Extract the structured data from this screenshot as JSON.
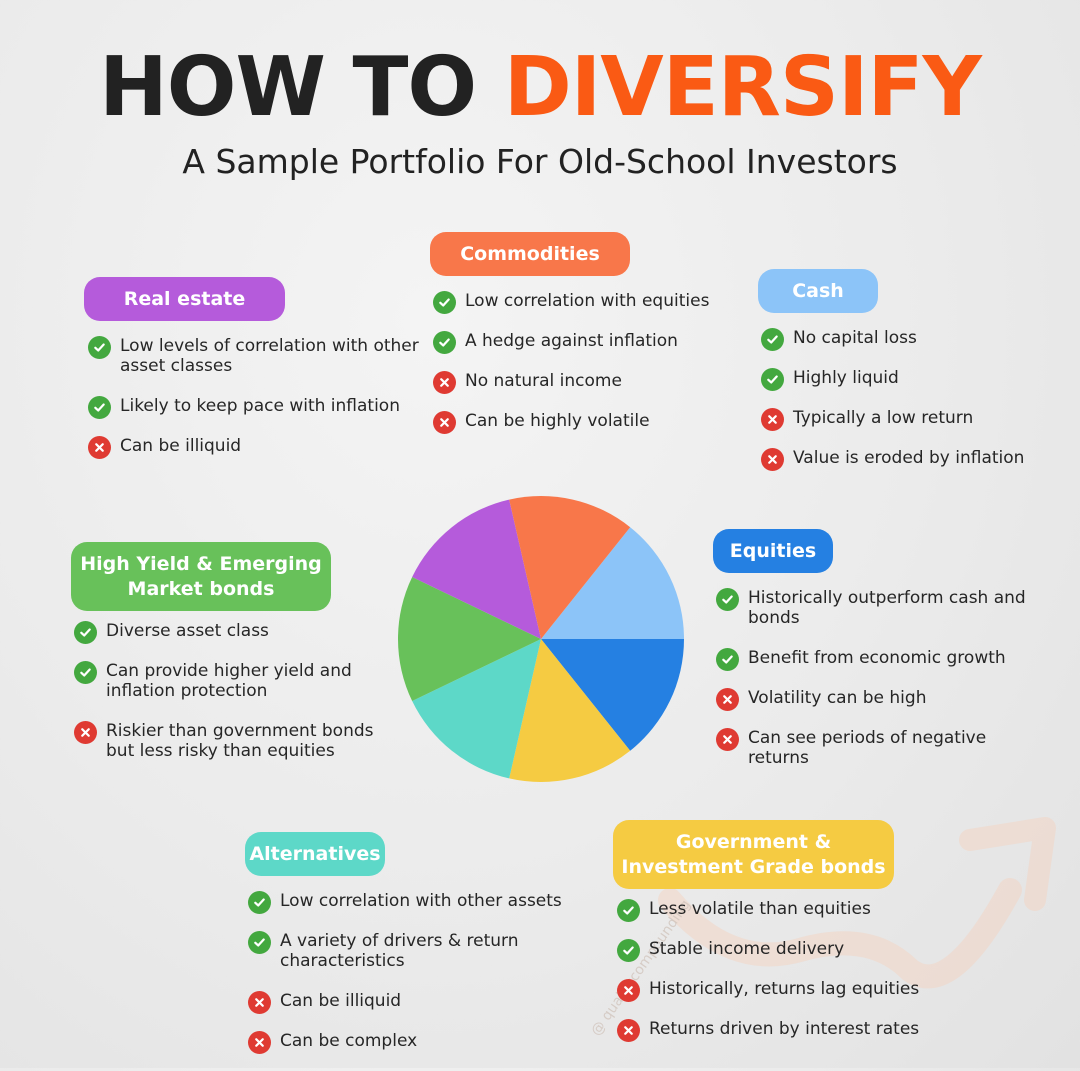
{
  "title": {
    "part1": "HOW TO ",
    "part2": "DIVERSIFY"
  },
  "subtitle": "A Sample Portfolio For Old-School Investors",
  "colors": {
    "accent": "#fa5a14",
    "pro": "#43a83f",
    "con": "#df3a32"
  },
  "icons": {
    "pro": "check-circle-icon",
    "con": "cross-circle-icon"
  },
  "watermark": "@ qualitycompounding",
  "categories": {
    "real_estate": {
      "label": "Real estate",
      "color": "#b55bdb",
      "items": [
        {
          "type": "pro",
          "text": "Low levels of correlation with other asset classes"
        },
        {
          "type": "pro",
          "text": "Likely to keep pace with inflation"
        },
        {
          "type": "con",
          "text": "Can be illiquid"
        }
      ]
    },
    "commodities": {
      "label": "Commodities",
      "color": "#f8774a",
      "items": [
        {
          "type": "pro",
          "text": "Low correlation with equities"
        },
        {
          "type": "pro",
          "text": "A hedge against inflation"
        },
        {
          "type": "con",
          "text": "No natural income"
        },
        {
          "type": "con",
          "text": "Can be highly volatile"
        }
      ]
    },
    "cash": {
      "label": "Cash",
      "color": "#8cc4f8",
      "items": [
        {
          "type": "pro",
          "text": "No capital loss"
        },
        {
          "type": "pro",
          "text": "Highly liquid"
        },
        {
          "type": "con",
          "text": "Typically a low return"
        },
        {
          "type": "con",
          "text": "Value is eroded by inflation"
        }
      ]
    },
    "high_yield": {
      "label": "High Yield & Emerging Market bonds",
      "color": "#68c15a",
      "items": [
        {
          "type": "pro",
          "text": "Diverse asset class"
        },
        {
          "type": "pro",
          "text": "Can provide higher yield and inflation protection"
        },
        {
          "type": "con",
          "text": "Riskier than government bonds but less risky than equities"
        }
      ]
    },
    "equities": {
      "label": "Equities",
      "color": "#2580e2",
      "items": [
        {
          "type": "pro",
          "text": "Historically outperform cash and bonds"
        },
        {
          "type": "pro",
          "text": "Benefit from economic growth"
        },
        {
          "type": "con",
          "text": "Volatility can be high"
        },
        {
          "type": "con",
          "text": "Can see periods of negative returns"
        }
      ]
    },
    "alternatives": {
      "label": "Alternatives",
      "color": "#5dd8c8",
      "items": [
        {
          "type": "pro",
          "text": "Low correlation with other assets"
        },
        {
          "type": "pro",
          "text": "A variety of drivers & return characteristics"
        },
        {
          "type": "con",
          "text": "Can be illiquid"
        },
        {
          "type": "con",
          "text": "Can be complex"
        }
      ]
    },
    "government": {
      "label": "Government & Investment Grade bonds",
      "color": "#f5cb42",
      "items": [
        {
          "type": "pro",
          "text": "Less volatile than equities"
        },
        {
          "type": "pro",
          "text": "Stable income delivery"
        },
        {
          "type": "con",
          "text": "Historically, returns lag equities"
        },
        {
          "type": "con",
          "text": "Returns driven by interest rates"
        }
      ]
    }
  },
  "pie": {
    "slices": [
      {
        "category": "cash",
        "value": 1,
        "color": "#8cc4f8"
      },
      {
        "category": "equities",
        "value": 1,
        "color": "#2580e2"
      },
      {
        "category": "government",
        "value": 1,
        "color": "#f5cb42"
      },
      {
        "category": "alternatives",
        "value": 1,
        "color": "#5dd8c8"
      },
      {
        "category": "high_yield",
        "value": 1,
        "color": "#68c15a"
      },
      {
        "category": "real_estate",
        "value": 1,
        "color": "#b55bdb"
      },
      {
        "category": "commodities",
        "value": 1,
        "color": "#f8774a"
      }
    ]
  }
}
